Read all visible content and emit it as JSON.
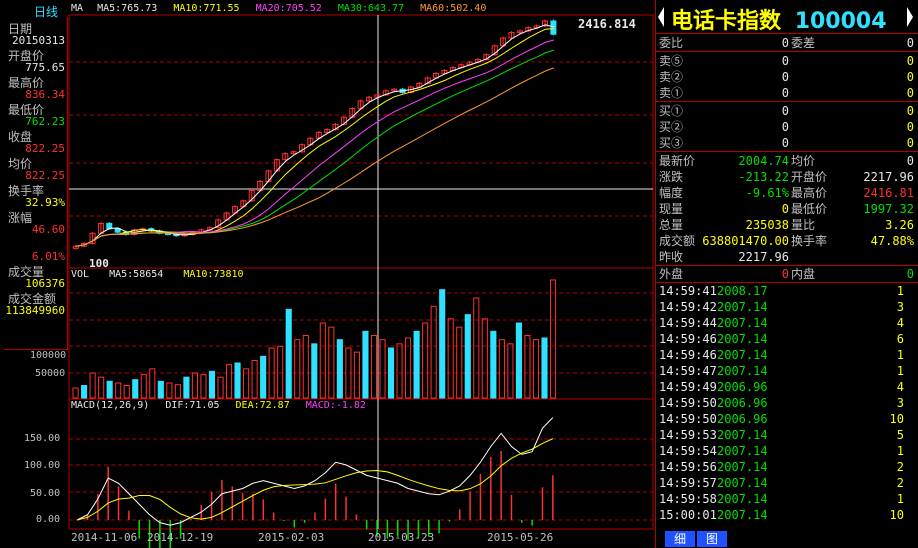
{
  "period_label": "日线",
  "left_panel": [
    {
      "label": "日期",
      "value": "20150313",
      "color": "wht"
    },
    {
      "label": "开盘价",
      "value": "775.65",
      "color": "wht"
    },
    {
      "label": "最高价",
      "value": "836.34",
      "color": "red"
    },
    {
      "label": "最低价",
      "value": "762.23",
      "color": "grn"
    },
    {
      "label": "收盘",
      "value": "822.25",
      "color": "red"
    },
    {
      "label": "均价",
      "value": "822.25",
      "color": "red"
    },
    {
      "label": "换手率",
      "value": "32.93%",
      "color": "yel"
    },
    {
      "label": "涨幅",
      "value": "46.60",
      "color": "red"
    },
    {
      "label": "",
      "value": "6.01%",
      "color": "red"
    },
    {
      "label": "成交量",
      "value": "106376",
      "color": "yel"
    },
    {
      "label": "成交金额",
      "value": "113849960",
      "color": "yel"
    }
  ],
  "ma_legend": {
    "prefix": "MA",
    "ma5": "MA5:765.73",
    "ma10": "MA10:771.55",
    "ma20": "MA20:705.52",
    "ma30": "MA30:643.77",
    "ma60": "MA60:502.40"
  },
  "vol_legend": {
    "prefix": "VOL",
    "ma5": "MA5:58654",
    "ma10": "MA10:73810"
  },
  "macd_legend": {
    "prefix": "MACD(12,26,9)",
    "dif": "DIF:71.05",
    "dea": "DEA:72.87",
    "macd": "MACD:-1.82"
  },
  "price_peak_label": "2416.814",
  "price_low_label": "100",
  "vol_axis": [
    "100000",
    "50000"
  ],
  "macd_axis": [
    "150.00",
    "100.00",
    "50.00",
    "0.00"
  ],
  "date_axis": [
    "2014-11-06",
    "2014-12-19",
    "2015-02-03",
    "2015-03-23",
    "2015-05-26"
  ],
  "title": {
    "name": "电话卡指数",
    "code": "100004"
  },
  "order_book": {
    "wb_label": "委比",
    "wb_value": "0",
    "wc_label": "委差",
    "wc_value": "0",
    "sell": [
      {
        "label": "卖⑤",
        "price": "0",
        "vol": "0"
      },
      {
        "label": "卖②",
        "price": "0",
        "vol": "0"
      },
      {
        "label": "卖①",
        "price": "0",
        "vol": "0"
      }
    ],
    "buy": [
      {
        "label": "买①",
        "price": "0",
        "vol": "0"
      },
      {
        "label": "买②",
        "price": "0",
        "vol": "0"
      },
      {
        "label": "买③",
        "price": "0",
        "vol": "0"
      }
    ]
  },
  "quote": [
    {
      "l1": "最新价",
      "v1": "2004.74",
      "c1": "grn",
      "l2": "均价",
      "v2": "0",
      "c2": "wht"
    },
    {
      "l1": "涨跌",
      "v1": "-213.22",
      "c1": "grn",
      "l2": "开盘价",
      "v2": "2217.96",
      "c2": "wht"
    },
    {
      "l1": "幅度",
      "v1": "-9.61%",
      "c1": "grn",
      "l2": "最高价",
      "v2": "2416.81",
      "c2": "red"
    },
    {
      "l1": "现量",
      "v1": "0",
      "c1": "yel",
      "l2": "最低价",
      "v2": "1997.32",
      "c2": "grn"
    },
    {
      "l1": "总量",
      "v1": "235038",
      "c1": "yel",
      "l2": "量比",
      "v2": "3.26",
      "c2": "yel"
    },
    {
      "l1": "成交额",
      "v1": "638801470.00",
      "c1": "yel",
      "l2": "换手率",
      "v2": "47.88%",
      "c2": "yel"
    },
    {
      "l1": "昨收",
      "v1": "2217.96",
      "c1": "wht",
      "l2": "",
      "v2": "",
      "c2": "wht"
    }
  ],
  "outer_label": "外盘",
  "outer_value": "0",
  "inner_label": "内盘",
  "inner_value": "0",
  "ticks": [
    {
      "time": "14:59:41",
      "price": "2008.17",
      "vol": "1"
    },
    {
      "time": "14:59:42",
      "price": "2007.14",
      "vol": "3"
    },
    {
      "time": "14:59:44",
      "price": "2007.14",
      "vol": "4"
    },
    {
      "time": "14:59:46",
      "price": "2007.14",
      "vol": "6"
    },
    {
      "time": "14:59:46",
      "price": "2007.14",
      "vol": "1"
    },
    {
      "time": "14:59:47",
      "price": "2007.14",
      "vol": "1"
    },
    {
      "time": "14:59:49",
      "price": "2006.96",
      "vol": "4"
    },
    {
      "time": "14:59:50",
      "price": "2006.96",
      "vol": "3"
    },
    {
      "time": "14:59:50",
      "price": "2006.96",
      "vol": "10"
    },
    {
      "time": "14:59:53",
      "price": "2007.14",
      "vol": "5"
    },
    {
      "time": "14:59:54",
      "price": "2007.14",
      "vol": "1"
    },
    {
      "time": "14:59:56",
      "price": "2007.14",
      "vol": "2"
    },
    {
      "time": "14:59:57",
      "price": "2007.14",
      "vol": "2"
    },
    {
      "time": "14:59:58",
      "price": "2007.14",
      "vol": "1"
    },
    {
      "time": "15:00:01",
      "price": "2007.14",
      "vol": "10"
    }
  ],
  "bottom_buttons": [
    "细",
    "图"
  ],
  "colors": {
    "up": "#ff3030",
    "down": "#30e0ff",
    "grid": "#b00000",
    "ma5": "#ffffff",
    "ma10": "#ffff00",
    "ma20": "#ff40ff",
    "ma30": "#00e000",
    "ma60": "#ff9a30"
  },
  "chart_data": {
    "type": "candlestick",
    "price_closes": [
      100,
      104,
      120,
      138,
      128,
      122,
      118,
      126,
      128,
      124,
      120,
      118,
      116,
      118,
      122,
      126,
      130,
      145,
      160,
      175,
      190,
      220,
      250,
      290,
      340,
      370,
      380,
      420,
      460,
      500,
      520,
      560,
      620,
      700,
      780,
      822,
      850,
      900,
      920,
      880,
      950,
      1000,
      1080,
      1150,
      1200,
      1250,
      1300,
      1350,
      1400,
      1500,
      1700,
      1900,
      2050,
      2100,
      2200,
      2250,
      2416,
      2004
    ],
    "volume_values": [
      12000,
      15000,
      30000,
      25000,
      20000,
      18000,
      15000,
      22000,
      28000,
      35000,
      20000,
      18000,
      16000,
      25000,
      30000,
      28000,
      32000,
      25000,
      40000,
      42000,
      35000,
      45000,
      50000,
      60000,
      62000,
      106376,
      70000,
      75000,
      65000,
      90000,
      85000,
      70000,
      60000,
      55000,
      80000,
      75000,
      70000,
      60000,
      65000,
      72000,
      80000,
      90000,
      110000,
      130000,
      95000,
      85000,
      100000,
      120000,
      95000,
      80000,
      70000,
      65000,
      90000,
      75000,
      70000,
      72000,
      235038
    ],
    "macd_dif": [
      0,
      10,
      40,
      80,
      70,
      50,
      30,
      10,
      -5,
      -10,
      -5,
      5,
      15,
      30,
      50,
      55,
      60,
      70,
      75,
      70,
      65,
      60,
      65,
      75,
      90,
      110,
      105,
      95,
      85,
      80,
      75,
      70,
      60,
      55,
      50,
      48,
      55,
      65,
      85,
      110,
      140,
      165,
      140,
      125,
      130,
      175,
      195
    ],
    "ylim_macd": [
      -10,
      200
    ],
    "ylim_vol": [
      0,
      120000
    ]
  }
}
